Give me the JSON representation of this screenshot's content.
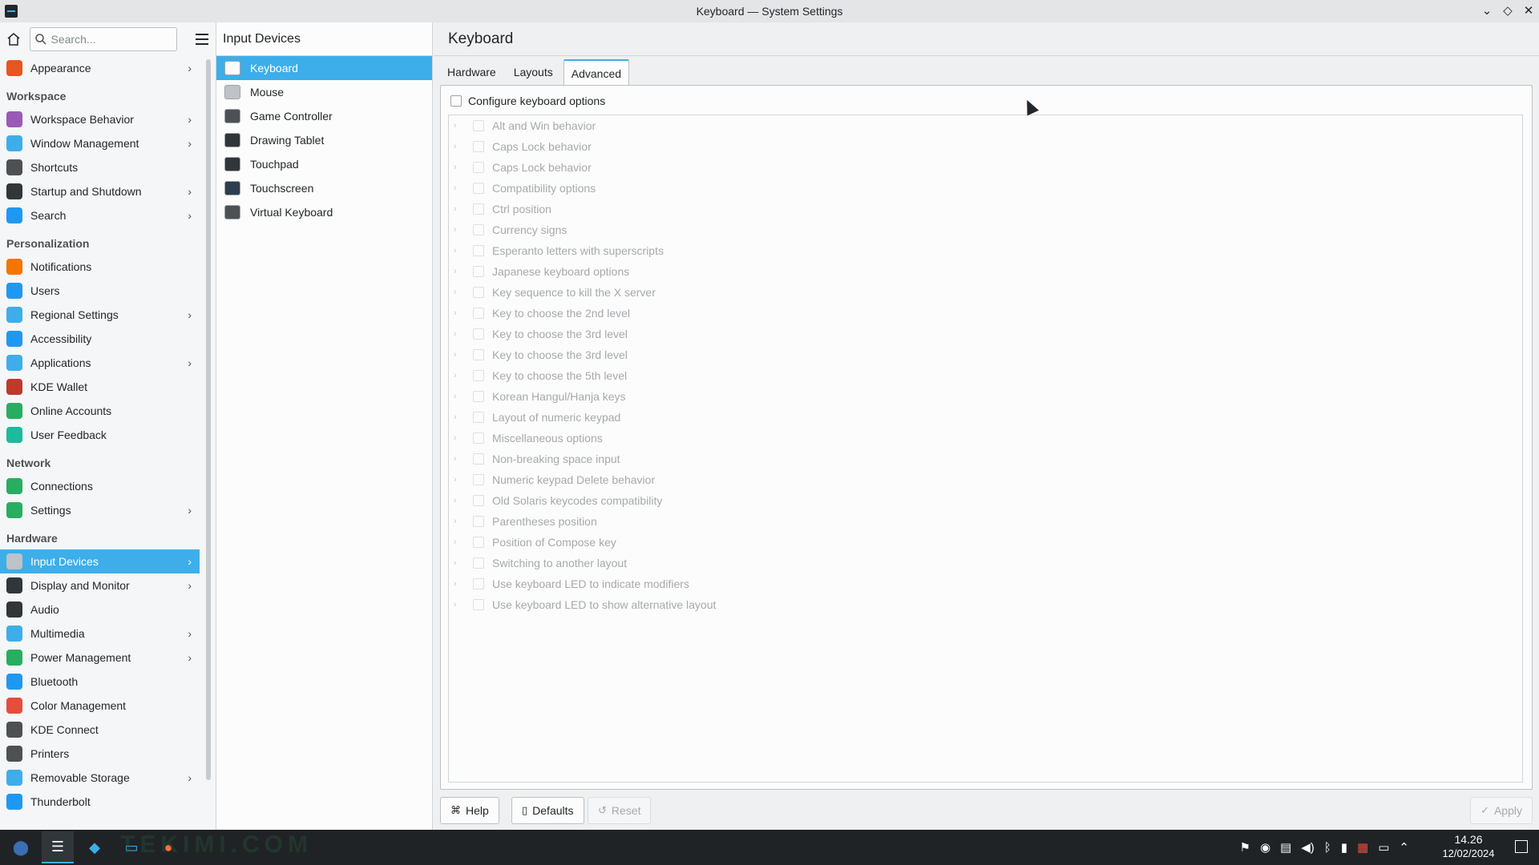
{
  "window": {
    "title": "Keyboard — System Settings",
    "controls": [
      "chevron-down-icon",
      "diamond-icon",
      "close-icon"
    ]
  },
  "sidebar": {
    "search_placeholder": "Search...",
    "entries": [
      {
        "kind": "item",
        "label": "Appearance",
        "chevron": true,
        "color": "#e95420"
      },
      {
        "kind": "header",
        "label": "Workspace"
      },
      {
        "kind": "item",
        "label": "Workspace Behavior",
        "chevron": true,
        "color": "#9b59b6"
      },
      {
        "kind": "item",
        "label": "Window Management",
        "chevron": true,
        "color": "#3daee9"
      },
      {
        "kind": "item",
        "label": "Shortcuts",
        "chevron": false,
        "color": "#4d5154"
      },
      {
        "kind": "item",
        "label": "Startup and Shutdown",
        "chevron": true,
        "color": "#31363b"
      },
      {
        "kind": "item",
        "label": "Search",
        "chevron": true,
        "color": "#1d99f3"
      },
      {
        "kind": "header",
        "label": "Personalization"
      },
      {
        "kind": "item",
        "label": "Notifications",
        "chevron": false,
        "color": "#f67400"
      },
      {
        "kind": "item",
        "label": "Users",
        "chevron": false,
        "color": "#1d99f3"
      },
      {
        "kind": "item",
        "label": "Regional Settings",
        "chevron": true,
        "color": "#3daee9"
      },
      {
        "kind": "item",
        "label": "Accessibility",
        "chevron": false,
        "color": "#1d99f3"
      },
      {
        "kind": "item",
        "label": "Applications",
        "chevron": true,
        "color": "#3daee9"
      },
      {
        "kind": "item",
        "label": "KDE Wallet",
        "chevron": false,
        "color": "#c0392b"
      },
      {
        "kind": "item",
        "label": "Online Accounts",
        "chevron": false,
        "color": "#27ae60"
      },
      {
        "kind": "item",
        "label": "User Feedback",
        "chevron": false,
        "color": "#1abc9c"
      },
      {
        "kind": "header",
        "label": "Network"
      },
      {
        "kind": "item",
        "label": "Connections",
        "chevron": false,
        "color": "#27ae60"
      },
      {
        "kind": "item",
        "label": "Settings",
        "chevron": true,
        "color": "#27ae60"
      },
      {
        "kind": "header",
        "label": "Hardware"
      },
      {
        "kind": "item",
        "label": "Input Devices",
        "chevron": true,
        "color": "#bdc3c7",
        "active": true
      },
      {
        "kind": "item",
        "label": "Display and Monitor",
        "chevron": true,
        "color": "#31363b"
      },
      {
        "kind": "item",
        "label": "Audio",
        "chevron": false,
        "color": "#31363b"
      },
      {
        "kind": "item",
        "label": "Multimedia",
        "chevron": true,
        "color": "#3daee9"
      },
      {
        "kind": "item",
        "label": "Power Management",
        "chevron": true,
        "color": "#27ae60"
      },
      {
        "kind": "item",
        "label": "Bluetooth",
        "chevron": false,
        "color": "#1d99f3"
      },
      {
        "kind": "item",
        "label": "Color Management",
        "chevron": false,
        "color": "#e74c3c"
      },
      {
        "kind": "item",
        "label": "KDE Connect",
        "chevron": false,
        "color": "#4d5154"
      },
      {
        "kind": "item",
        "label": "Printers",
        "chevron": false,
        "color": "#4d5154"
      },
      {
        "kind": "item",
        "label": "Removable Storage",
        "chevron": true,
        "color": "#3daee9"
      },
      {
        "kind": "item",
        "label": "Thunderbolt",
        "chevron": false,
        "color": "#1d99f3"
      }
    ]
  },
  "category": {
    "title": "Input Devices",
    "items": [
      {
        "label": "Keyboard",
        "active": true,
        "icon": "keyboard-icon",
        "color": "#fcfcfc"
      },
      {
        "label": "Mouse",
        "icon": "mouse-icon",
        "color": "#bdc3c7"
      },
      {
        "label": "Game Controller",
        "icon": "gamepad-icon",
        "color": "#4d5154"
      },
      {
        "label": "Drawing Tablet",
        "icon": "tablet-icon",
        "color": "#31363b"
      },
      {
        "label": "Touchpad",
        "icon": "touchpad-icon",
        "color": "#31363b"
      },
      {
        "label": "Touchscreen",
        "icon": "touchscreen-icon",
        "color": "#2c3e50"
      },
      {
        "label": "Virtual Keyboard",
        "icon": "virtual-keyboard-icon",
        "color": "#4d5154"
      }
    ]
  },
  "main": {
    "title": "Keyboard",
    "tabs": [
      {
        "label": "Hardware"
      },
      {
        "label": "Layouts"
      },
      {
        "label": "Advanced",
        "active": true
      }
    ],
    "configure_label": "Configure keyboard options",
    "options": [
      "Alt and Win behavior",
      "Caps Lock behavior",
      "Caps Lock behavior",
      "Compatibility options",
      "Ctrl position",
      "Currency signs",
      "Esperanto letters with superscripts",
      "Japanese keyboard options",
      "Key sequence to kill the X server",
      "Key to choose the 2nd level",
      "Key to choose the 3rd level",
      "Key to choose the 3rd level",
      "Key to choose the 5th level",
      "Korean Hangul/Hanja keys",
      "Layout of numeric keypad",
      "Miscellaneous options",
      "Non-breaking space input",
      "Numeric keypad Delete behavior",
      "Old Solaris keycodes compatibility",
      "Parentheses position",
      "Position of Compose key",
      "Switching to another layout",
      "Use keyboard LED to indicate modifiers",
      "Use keyboard LED to show alternative layout"
    ],
    "buttons": {
      "help": "Help",
      "defaults": "Defaults",
      "reset": "Reset",
      "apply": "Apply"
    }
  },
  "taskbar": {
    "time": "14.26",
    "date": "12/02/2024",
    "watermark": "TEKIMI.COM"
  }
}
